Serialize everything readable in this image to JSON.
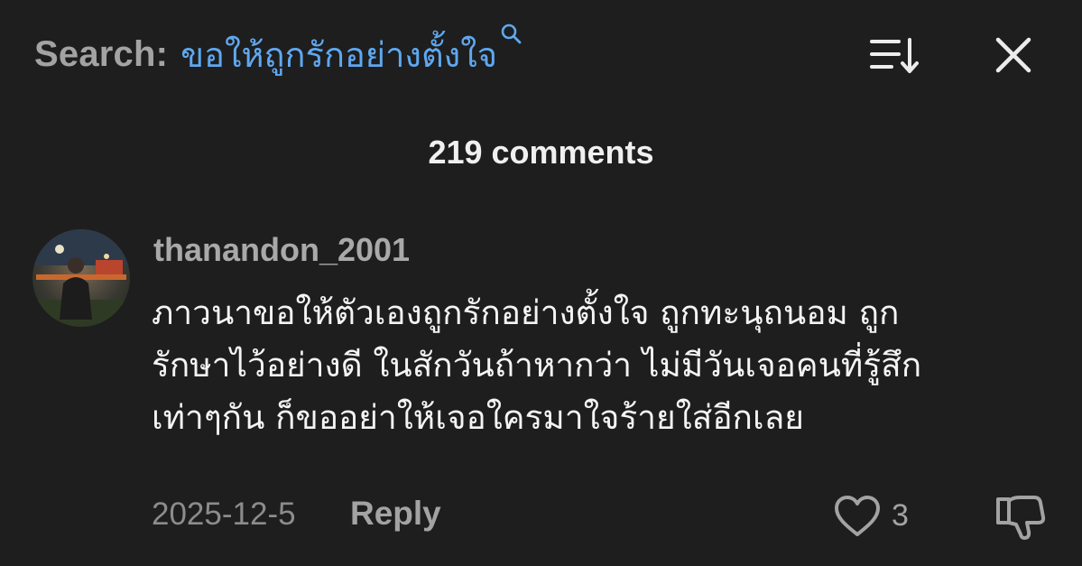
{
  "search": {
    "prefix": "Search:",
    "query": "ขอให้ถูกรักอย่างตั้งใจ"
  },
  "header": {
    "comment_count": "219 comments"
  },
  "comment": {
    "username": "thanandon_2001",
    "lines": [
      "ภาวนาขอให้ตัวเองถูกรักอย่างตั้งใจ ถูกทะนุถนอม ถูก",
      "รักษาไว้อย่างดี ในสักวันถ้าหากว่า ไม่มีวันเจอคนที่รู้สึก",
      "เท่าๆกัน ก็ขออย่าให้เจอใครมาใจร้ายใส่อีกเลย"
    ],
    "date": "2025-12-5",
    "reply_label": "Reply",
    "like_count": "3"
  },
  "colors": {
    "background": "#1e1e1e",
    "search_query": "#5fa8f0",
    "muted_text": "#a3a3a3"
  },
  "icons": {
    "search": "search-icon",
    "sort": "sort-icon",
    "close": "close-icon",
    "like": "heart-icon",
    "dislike": "thumbs-down-icon"
  }
}
